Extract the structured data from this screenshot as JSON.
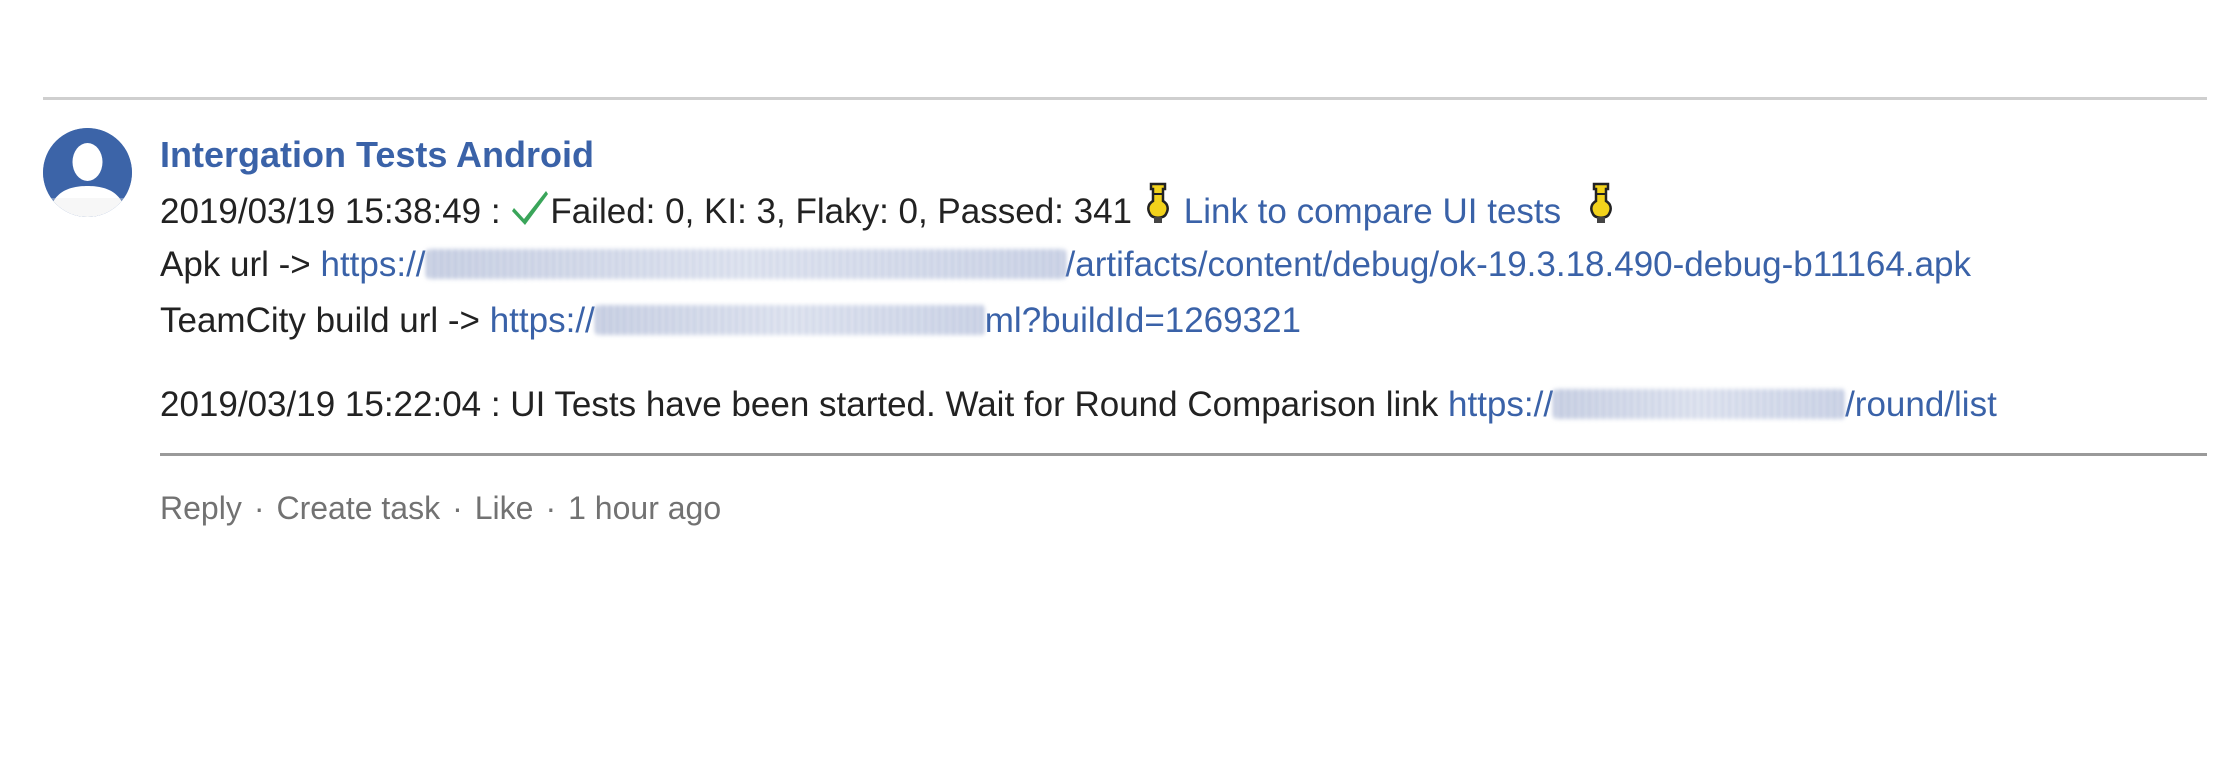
{
  "post": {
    "author": "Intergation Tests Android",
    "result_line": {
      "timestamp": "2019/03/19 15:38:49 :",
      "status_icon": "check-icon",
      "summary": "Failed: 0, KI: 3, Flaky: 0, Passed: 341",
      "left_icon": "flask-icon",
      "compare_link": "Link to compare UI tests",
      "right_icon": "flask-icon"
    },
    "apk_line": {
      "label": "Apk url ->",
      "link_prefix": "https://",
      "link_suffix": "/artifacts/content/debug/ok-19.3.18.490-debug-b11164.apk"
    },
    "teamcity_line": {
      "label": "TeamCity build url ->",
      "link_prefix": "https://",
      "link_suffix": "ml?buildId=1269321"
    },
    "started_line": {
      "text": "2019/03/19 15:22:04 : UI Tests have been started. Wait for Round Comparison link",
      "link_prefix": "https://",
      "link_suffix": "/round/list"
    }
  },
  "actions": {
    "reply": "Reply",
    "create_task": "Create task",
    "like": "Like",
    "separator": "·",
    "time_ago": "1 hour ago"
  },
  "colors": {
    "link": "#3a62a8",
    "success": "#3aa55a",
    "muted": "#727272"
  }
}
